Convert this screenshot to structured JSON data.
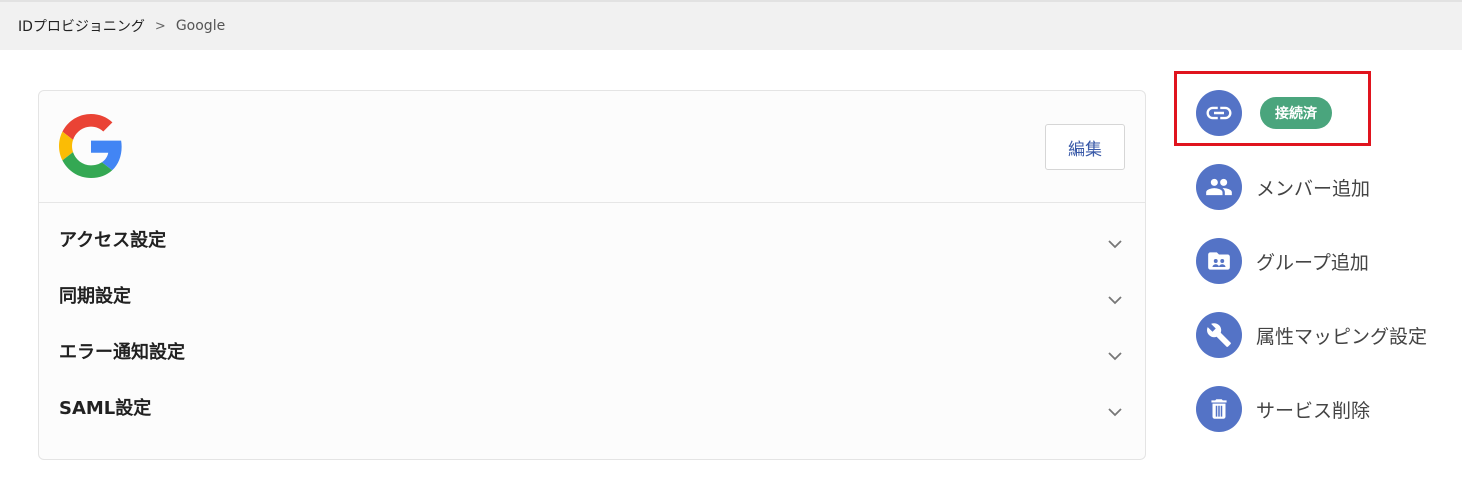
{
  "breadcrumb": {
    "root": "IDプロビジョニング",
    "separator": ">",
    "current": "Google"
  },
  "card": {
    "logo_icon": "google-logo",
    "edit_label": "編集",
    "sections": [
      {
        "title": "アクセス設定"
      },
      {
        "title": "同期設定"
      },
      {
        "title": "エラー通知設定"
      },
      {
        "title": "SAML設定"
      }
    ]
  },
  "actions": {
    "connection": {
      "icon": "link-icon",
      "status": "接続済"
    },
    "add_member": {
      "icon": "users-icon",
      "label": "メンバー追加"
    },
    "add_group": {
      "icon": "group-folder-icon",
      "label": "グループ追加"
    },
    "attribute_mapping": {
      "icon": "wrench-icon",
      "label": "属性マッピング設定"
    },
    "delete_service": {
      "icon": "trash-icon",
      "label": "サービス削除"
    }
  },
  "colors": {
    "accent": "#5473c6",
    "status_green": "#4aa57d",
    "highlight_red": "#e0141e",
    "edit_text": "#3a5aa8"
  }
}
